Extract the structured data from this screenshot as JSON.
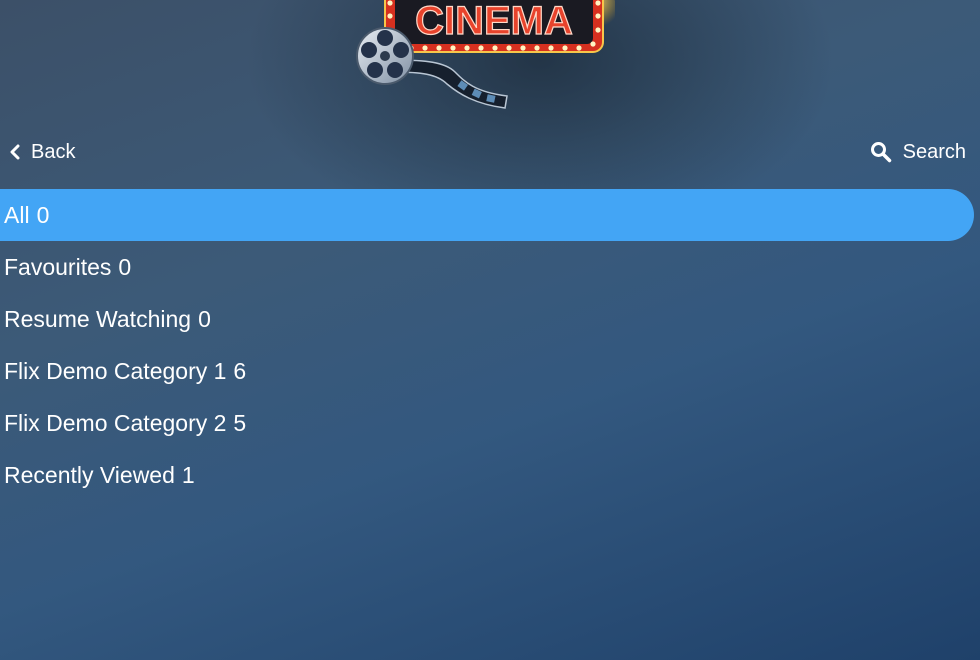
{
  "header": {
    "logo": {
      "text": "CINEMA",
      "icon": "film-reel-icon"
    },
    "back_label": "Back",
    "back_icon": "chevron-left-icon",
    "search_label": "Search",
    "search_icon": "search-icon"
  },
  "categories": [
    {
      "label": "All",
      "count": "0",
      "selected": true
    },
    {
      "label": "Favourites",
      "count": "0"
    },
    {
      "label": "Resume Watching",
      "count": "0"
    },
    {
      "label": "Flix Demo Category 1",
      "count": "6"
    },
    {
      "label": "Flix Demo Category 2",
      "count": "5"
    },
    {
      "label": "Recently Viewed",
      "count": "1"
    }
  ],
  "colors": {
    "selected_item": "#43a5f5",
    "logo_red": "#e8432c",
    "bulb": "#fff4c2"
  }
}
